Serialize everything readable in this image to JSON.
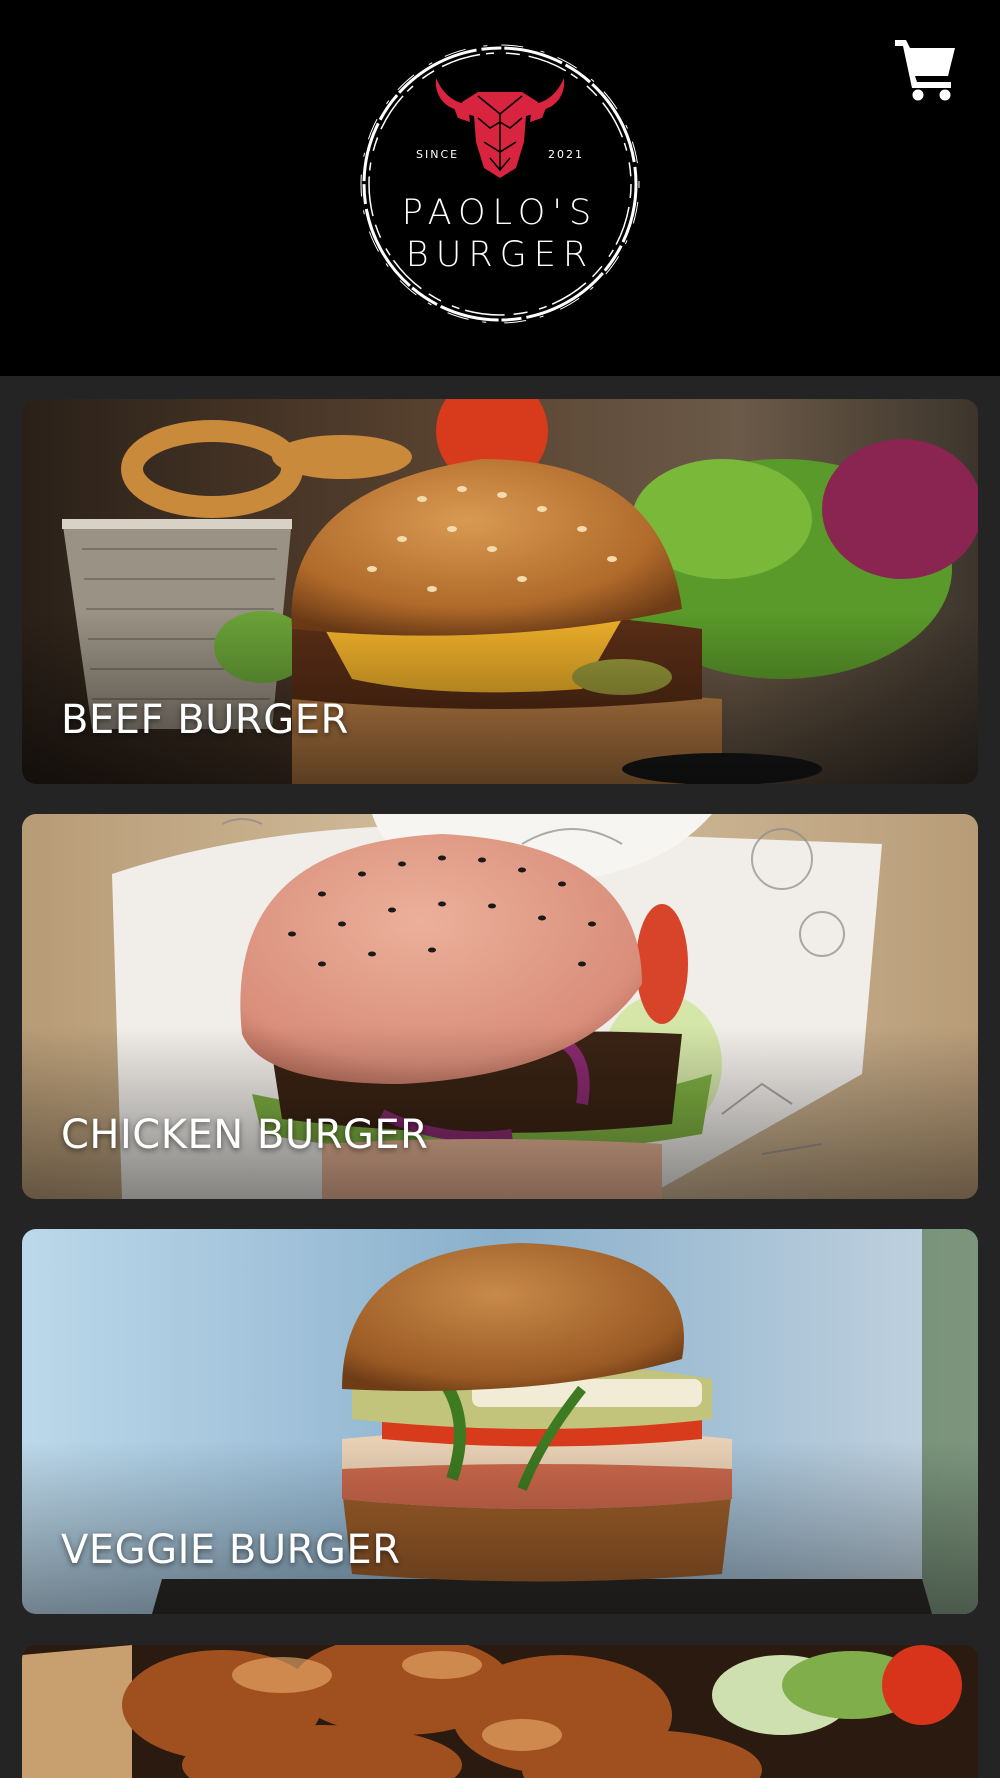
{
  "header": {
    "logo": {
      "line1": "PAOLO'S",
      "line2": "BURGER",
      "since": "SINCE",
      "year": "2021",
      "icon": "bull-head-icon",
      "accent_color": "#d8243f"
    },
    "cart_icon": "shopping-cart-icon"
  },
  "categories": [
    {
      "label": "BEEF BURGER"
    },
    {
      "label": "CHICKEN BURGER"
    },
    {
      "label": "VEGGIE BURGER"
    },
    {
      "label": ""
    }
  ],
  "colors": {
    "header_bg": "#000000",
    "page_bg": "#242424",
    "label_text": "#ffffff"
  }
}
